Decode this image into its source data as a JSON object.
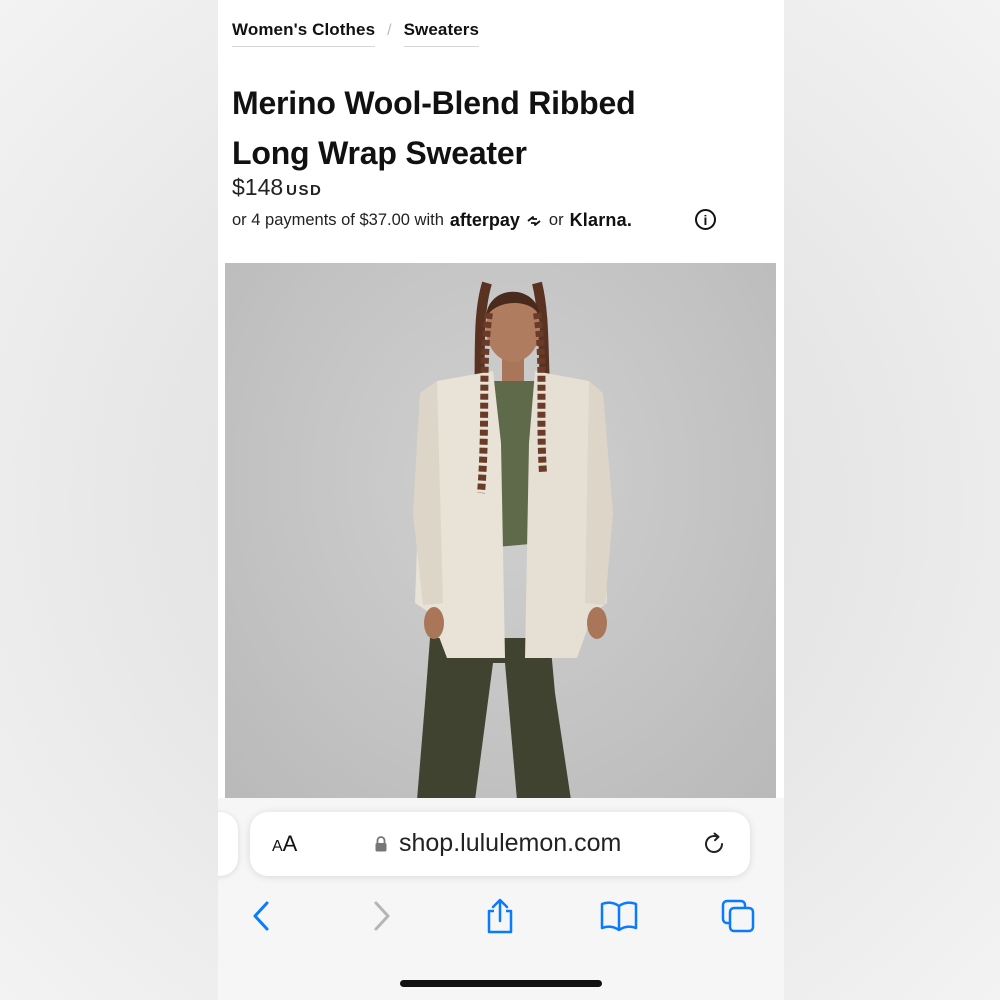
{
  "breadcrumb": [
    "Women's Clothes",
    "Sweaters"
  ],
  "product": {
    "title": "Merino Wool-Blend Ribbed Long Wrap Sweater",
    "price": "$148",
    "currency": "USD",
    "payments_prefix": "or 4 payments of $37.00 with",
    "afterpay": "afterpay",
    "or": "or",
    "klarna": "Klarna."
  },
  "browser": {
    "aa_label_small": "A",
    "aa_label": "A",
    "url": "shop.lululemon.com"
  },
  "icons": {
    "info": "info-icon",
    "lock": "lock-icon",
    "reload": "reload-icon",
    "back": "chevron-left-icon",
    "forward": "chevron-right-icon",
    "share": "share-icon",
    "bookmarks": "book-icon",
    "tabs": "tabs-icon"
  },
  "colors": {
    "accent": "#0a7aff",
    "disabled": "#b5b5b5"
  }
}
